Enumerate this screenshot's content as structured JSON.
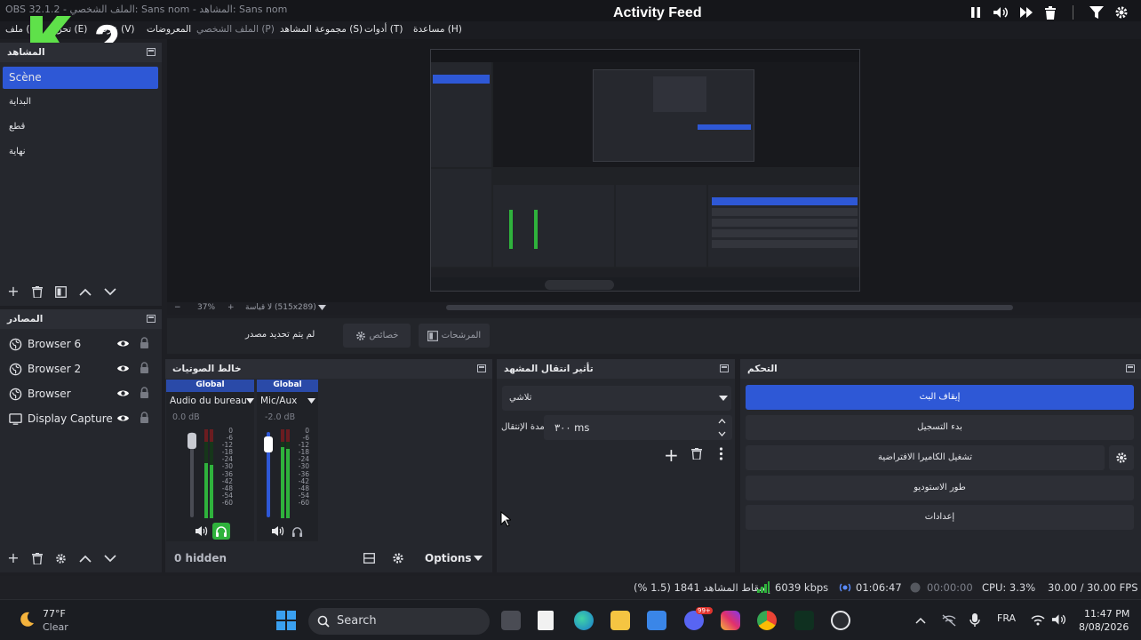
{
  "window": {
    "title": "OBS 32.1.2 - الملف الشخصي: Sans nom - المشاهد: Sans nom"
  },
  "overlay": {
    "activity_feed": "Activity Feed",
    "logo_text": "K 2"
  },
  "menu": {
    "items": [
      {
        "label": "ملف (F)",
        "dim": false
      },
      {
        "label": "تحرير (E)",
        "dim": false
      },
      {
        "label": "عرض (V)",
        "dim": false
      },
      {
        "label": "المعروضات",
        "dim": false
      },
      {
        "label": "الملف الشخصي (P)",
        "dim": true
      },
      {
        "label": "مجموعة المشاهد (S)",
        "dim": false
      },
      {
        "label": "أدوات (T)",
        "dim": false
      },
      {
        "label": "مساعدة (H)",
        "dim": false
      }
    ]
  },
  "scenes": {
    "header": "المشاهد",
    "items": [
      "Scène",
      "البداية",
      "قطع",
      "نهاية"
    ],
    "active_index": 0
  },
  "preview": {
    "zoom": "37%",
    "zoom_minus": "−",
    "zoom_plus": "+",
    "canvas_label": "لا قياسة (515x289)"
  },
  "context": {
    "no_source": "لم يتم تحديد مصدر",
    "properties": "خصائص",
    "filters": "المرشحات"
  },
  "sources": {
    "header": "المصادر",
    "items": [
      {
        "label": "Browser 6",
        "icon": "globe-icon"
      },
      {
        "label": "Browser 2",
        "icon": "globe-icon"
      },
      {
        "label": "Browser",
        "icon": "globe-icon"
      },
      {
        "label": "Display Capture",
        "icon": "monitor-icon"
      }
    ]
  },
  "mixer": {
    "header": "خالط الصوتيات",
    "channels": [
      {
        "badge": "Global",
        "name": "Audio du bureau",
        "db": "0.0 dB",
        "level": 0.62,
        "fader": 0.9
      },
      {
        "badge": "Global",
        "name": "Mic/Aux",
        "db": "-2.0 dB",
        "level": 0.8,
        "fader": 0.85
      }
    ],
    "scale": [
      "0",
      "-6",
      "-12",
      "-18",
      "-24",
      "-30",
      "-36",
      "-42",
      "-48",
      "-54",
      "-60"
    ],
    "hidden_count": "0 hidden",
    "options": "Options"
  },
  "transitions": {
    "header": "تأثير انتقال المشهد",
    "type": "تلاشي",
    "duration_label": "مدة الإنتقال",
    "duration_value": "٣٠٠ ms"
  },
  "controls": {
    "header": "التحكم",
    "buttons": [
      {
        "label": "إيقاف البث",
        "primary": true
      },
      {
        "label": "بدء التسجيل",
        "primary": false
      },
      {
        "label": "تشغيل الكاميرا الافتراضية",
        "primary": false
      },
      {
        "label": "طور الاستوديو",
        "primary": false
      },
      {
        "label": "إعدادات",
        "primary": false
      }
    ]
  },
  "status": {
    "dropped": "إسقاط المشاهد 1841 (1.5 %)",
    "bitrate": "6039 kbps",
    "stream_time": "01:06:47",
    "rec_time": "00:00:00",
    "cpu": "CPU: 3.3%",
    "fps": "30.00 / 30.00 FPS"
  },
  "taskbar": {
    "weather_temp": "77°F",
    "weather_desc": "Clear",
    "search": "Search",
    "lang": "FRA",
    "time": "11:47 PM",
    "date": "8/08/2026",
    "discord_badge": "99+"
  },
  "colors": {
    "accent": "#2e58d6",
    "panel": "#25272d",
    "meter_green": "#2fb23c"
  }
}
